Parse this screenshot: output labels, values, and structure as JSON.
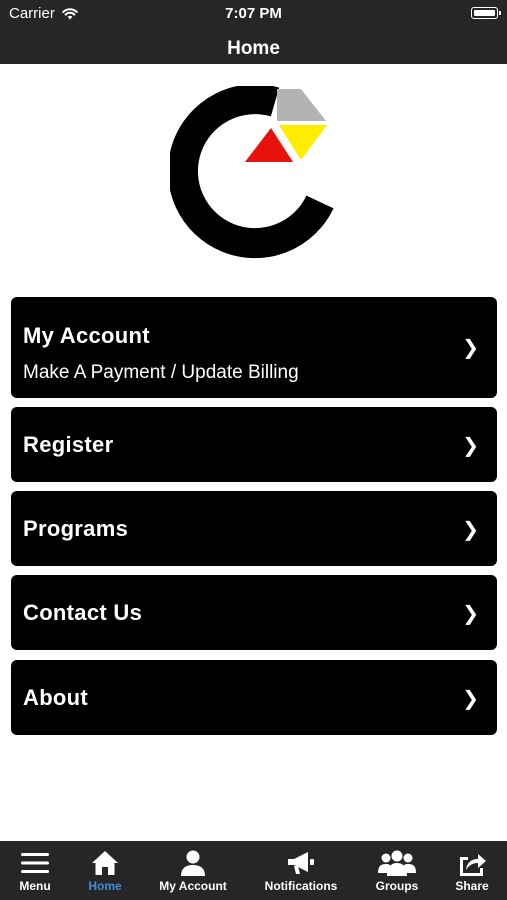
{
  "status_bar": {
    "carrier": "Carrier",
    "time": "7:07 PM",
    "battery_level": 1.0
  },
  "nav": {
    "title": "Home"
  },
  "logo": {
    "colors": {
      "ring": "#000000",
      "gray": "#b3b3b3",
      "yellow": "#ffed00",
      "red": "#e8120c"
    }
  },
  "menu": {
    "items": [
      {
        "title": "My Account",
        "subtitle": "Make A Payment / Update Billing",
        "chevron": "❯"
      },
      {
        "title": "Register",
        "chevron": "❯"
      },
      {
        "title": "Programs",
        "chevron": "❯"
      },
      {
        "title": "Contact Us",
        "chevron": "❯"
      },
      {
        "title": "About",
        "chevron": "❯"
      }
    ]
  },
  "tab_bar": {
    "active_color": "#3d8fd6",
    "tabs": [
      {
        "label": "Menu",
        "icon": "menu-icon"
      },
      {
        "label": "Home",
        "icon": "home-icon",
        "active": true
      },
      {
        "label": "My Account",
        "icon": "person-icon"
      },
      {
        "label": "Notifications",
        "icon": "megaphone-icon"
      },
      {
        "label": "Groups",
        "icon": "groups-icon"
      },
      {
        "label": "Share",
        "icon": "share-icon"
      }
    ]
  }
}
